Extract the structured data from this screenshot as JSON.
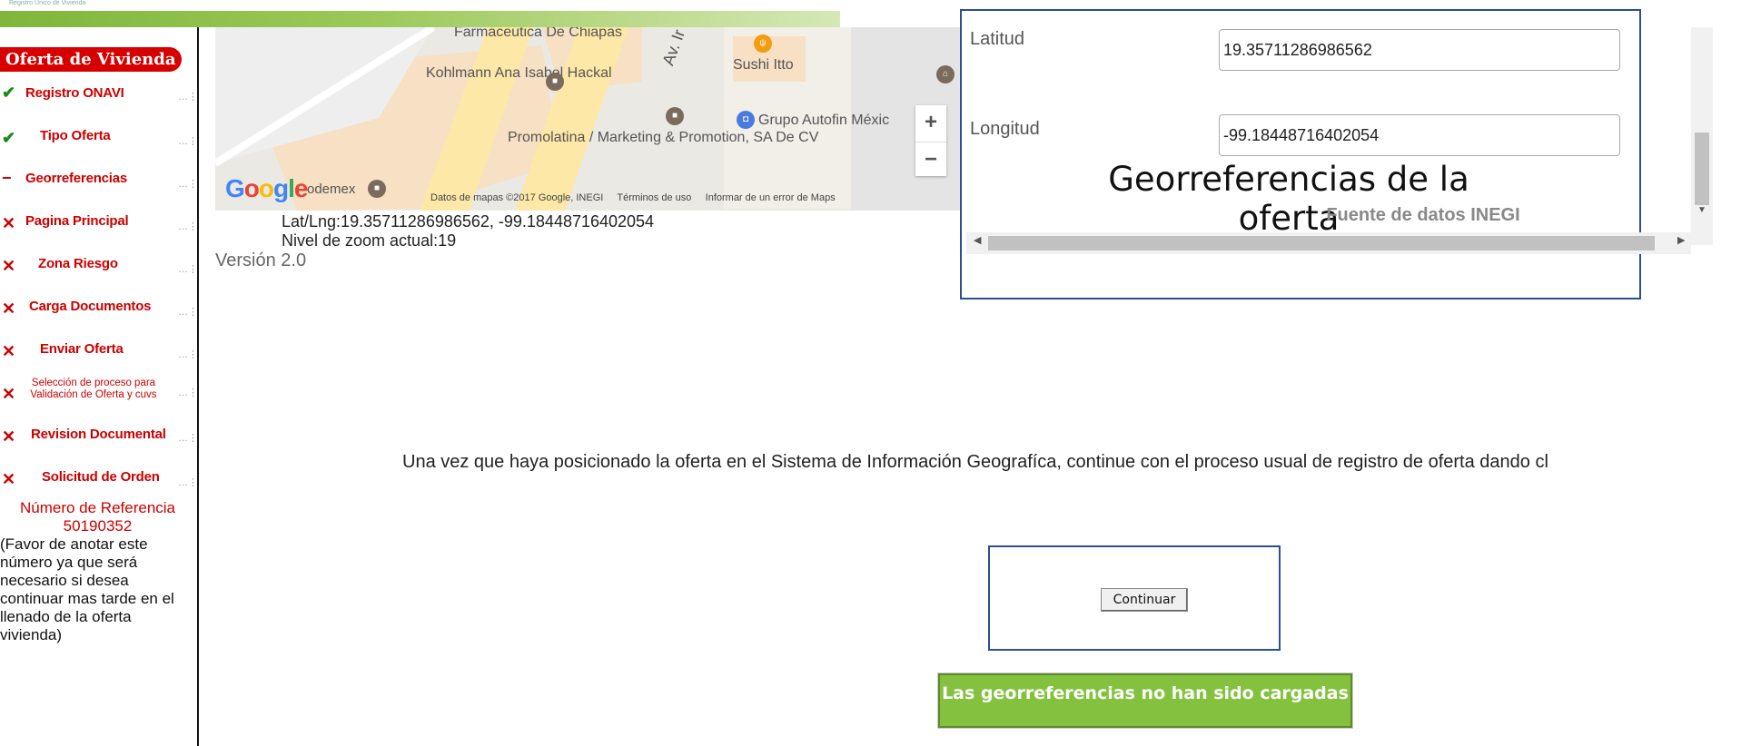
{
  "header": {
    "logo_text": "Registro Único de Vivienda"
  },
  "sidebar": {
    "title": "Oferta de Vivienda",
    "items": [
      {
        "label": "Registro ONAVI",
        "status": "done",
        "icon": "check-icon"
      },
      {
        "label": "Tipo Oferta",
        "status": "done",
        "icon": "check-icon"
      },
      {
        "label": "Georreferencias",
        "status": "current",
        "icon": "dash-icon"
      },
      {
        "label": "Pagina Principal",
        "status": "pending",
        "icon": "cross-icon"
      },
      {
        "label": "Zona Riesgo",
        "status": "pending",
        "icon": "cross-icon"
      },
      {
        "label": "Carga Documentos",
        "status": "pending",
        "icon": "cross-icon"
      },
      {
        "label": "Enviar Oferta",
        "status": "pending",
        "icon": "cross-icon"
      },
      {
        "label": "Selección de proceso para Validación de Oferta y cuvs",
        "status": "pending",
        "icon": "cross-icon"
      },
      {
        "label": "Revision Documental",
        "status": "pending",
        "icon": "cross-icon"
      },
      {
        "label": "Solicitud de Orden",
        "status": "pending",
        "icon": "cross-icon"
      }
    ],
    "reference": {
      "title": "Número de Referencia",
      "number": "50190352",
      "note": "(Favor de anotar este número ya que será necesario si desea continuar mas tarde en el llenado de la oferta vivienda)"
    }
  },
  "map": {
    "labels": {
      "farmaceutica": "Farmaceutica De Chiapas",
      "kohlmann": "Kohlmann Ana Isabel Hackal",
      "av": "Av. Ir",
      "sushi": "Sushi Itto",
      "autofin": "Grupo Autofin Méxic",
      "promolatina": "Promolatina / Marketing & Promotion, SA De CV",
      "odemex": "odemex"
    },
    "google_logo": "Google",
    "footer": {
      "datos": "Datos de mapas ©2017 Google, INEGI",
      "terminos": "Términos de uso",
      "reportar": "Informar de un error de Maps"
    },
    "zoom_in": "+",
    "zoom_out": "−",
    "latlng_text": "Lat/Lng:19.35711286986562, -99.18448716402054",
    "zoom_text": "Nivel de zoom actual:19",
    "version": "Versión 2.0"
  },
  "overlay": {
    "latitud_label": "Latitud",
    "latitud_value": "19.35711286986562",
    "longitud_label": "Longitud",
    "longitud_value": "-99.18448716402054",
    "caption": "Georreferencias de la oferta",
    "fuente": "Fuente de datos INEGI"
  },
  "main": {
    "instructions": "Una vez que haya posicionado la oferta en el Sistema de Información Geografíca, continue con el proceso usual de registro de oferta dando cl",
    "continuar_label": "Continuar",
    "alert": "Las georreferencias no han sido cargadas"
  },
  "colors": {
    "accent_green": "#84c13e",
    "error_red": "#cc0000",
    "frame_blue": "#2b4f8f"
  }
}
